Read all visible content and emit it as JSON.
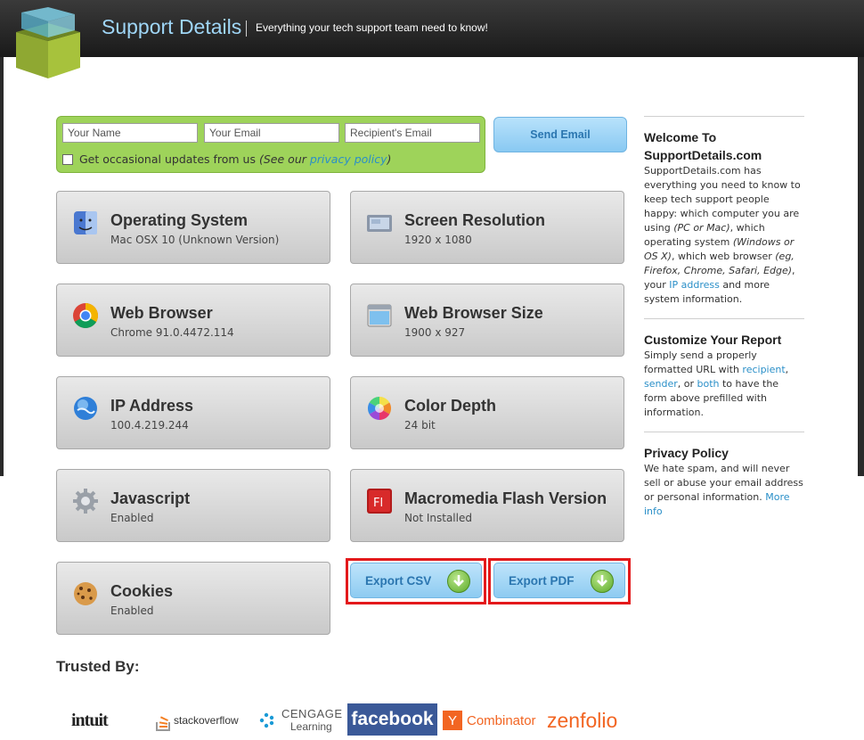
{
  "header": {
    "title": "Support Details",
    "tagline": "Everything your tech support team need to know!"
  },
  "email_form": {
    "name_placeholder": "Your Name",
    "email_placeholder": "Your Email",
    "recipient_placeholder": "Recipient's Email",
    "updates_label": "Get occasional updates from us",
    "see_our": "(See our",
    "privacy_link": "privacy policy",
    "close_paren": ")",
    "send_button": "Send Email"
  },
  "cards": [
    {
      "title": "Operating System",
      "value": "Mac OSX 10 (Unknown Version)",
      "icon": "finder-icon"
    },
    {
      "title": "Screen Resolution",
      "value": "1920 x 1080",
      "icon": "display-icon"
    },
    {
      "title": "Web Browser",
      "value": "Chrome 91.0.4472.114",
      "icon": "chrome-icon"
    },
    {
      "title": "Web Browser Size",
      "value": "1900 x 927",
      "icon": "browser-window-icon"
    },
    {
      "title": "IP Address",
      "value": "100.4.219.244",
      "icon": "globe-icon"
    },
    {
      "title": "Color Depth",
      "value": "24 bit",
      "icon": "color-wheel-icon"
    },
    {
      "title": "Javascript",
      "value": "Enabled",
      "icon": "gear-icon"
    },
    {
      "title": "Macromedia Flash Version",
      "value": "Not Installed",
      "icon": "flash-icon"
    },
    {
      "title": "Cookies",
      "value": "Enabled",
      "icon": "cookie-icon"
    }
  ],
  "export": {
    "csv": "Export CSV",
    "pdf": "Export PDF"
  },
  "sidebar": {
    "welcome": {
      "heading": "Welcome To SupportDetails.com",
      "t1": "SupportDetails.com has everything you need to know to keep tech support people happy: which computer you are using ",
      "e1": "(PC or Mac)",
      "t2": ", which operating system ",
      "e2": "(Windows or OS X)",
      "t3": ", which web browser ",
      "e3": "(eg, Firefox, Chrome, Safari, Edge)",
      "t4": ", your ",
      "link": "IP address",
      "t5": " and more system information."
    },
    "customize": {
      "heading": "Customize Your Report",
      "t1": "Simply send a properly formatted URL with ",
      "l1": "recipient",
      "t2": ", ",
      "l2": "sender",
      "t3": ", or ",
      "l3": "both",
      "t4": " to have the form above prefilled with information."
    },
    "privacy": {
      "heading": "Privacy Policy",
      "text": "We hate spam, and will never sell or abuse your email address or personal information. ",
      "link": "More info"
    }
  },
  "trusted": {
    "title": "Trusted By:",
    "logos": [
      "intuit",
      "stackoverflow",
      "CENGAGE",
      "Learning",
      "facebook",
      "Y",
      "Combinator",
      "zenfolio"
    ]
  },
  "colors": {
    "header_title": "#9fd6f7",
    "form_green": "#9ed35a",
    "link_blue": "#2a8fc8",
    "button_blue": "#89c9f2",
    "highlight_red": "#e3191b"
  }
}
